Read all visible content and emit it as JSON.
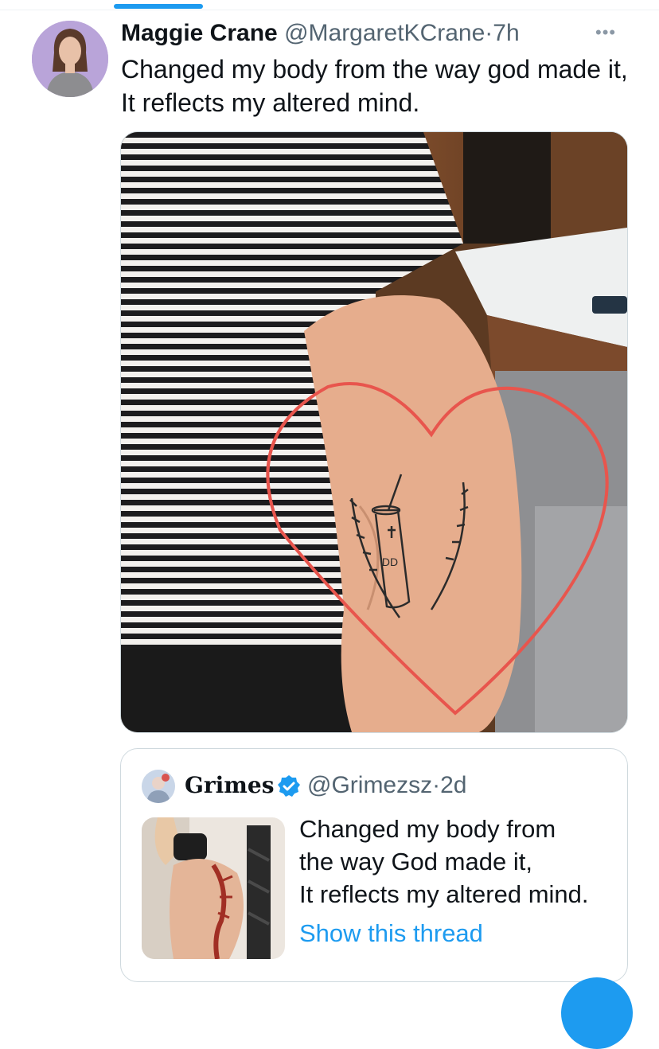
{
  "tweet": {
    "author_name": "Maggie Crane",
    "author_handle": "@MargaretKCrane",
    "separator": "·",
    "time": "7h",
    "text_lines": [
      "Changed my body from the way god made it,",
      "It reflects my altered mind."
    ],
    "more_label": "•••"
  },
  "quoted_tweet": {
    "author_name": "Grimes",
    "author_handle": "@Grimezsz",
    "separator": "·",
    "time": "2d",
    "text_lines": [
      "Changed my body from",
      "the way God made it,",
      "It reflects my altered mind."
    ],
    "show_thread": "Show this thread"
  },
  "media": {
    "tattoo_logo": "DD"
  },
  "colors": {
    "accent": "#1d9bf0",
    "secondary_text": "#536471",
    "border": "#cfd9de",
    "heart": "#e8554d"
  },
  "icons": [
    "more-icon",
    "verified-icon"
  ]
}
